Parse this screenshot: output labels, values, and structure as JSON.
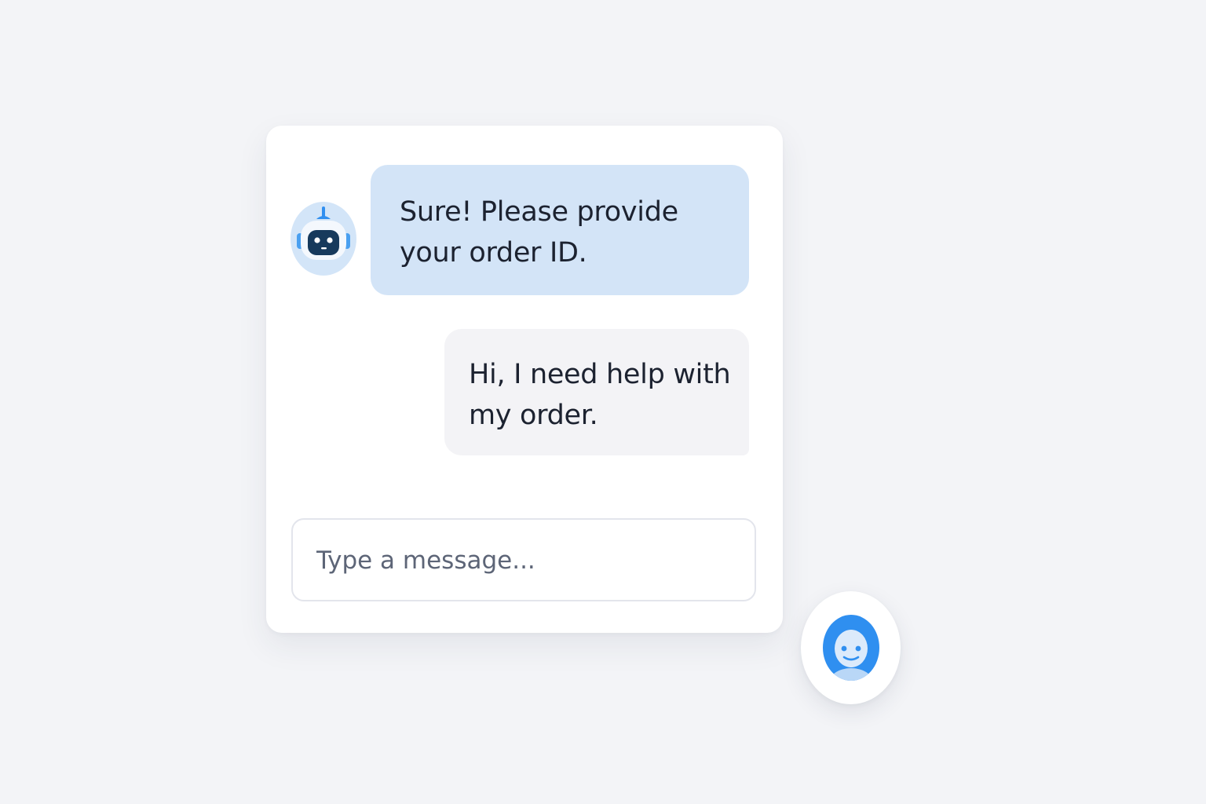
{
  "chat": {
    "messages": [
      {
        "sender": "bot",
        "text": "Sure! Please provide your order ID."
      },
      {
        "sender": "user",
        "text": "Hi, I need help with my order."
      }
    ],
    "input": {
      "placeholder": "Type a message...",
      "value": ""
    }
  },
  "icons": {
    "bot_avatar": "robot-icon",
    "launcher": "chatbot-face-icon"
  },
  "colors": {
    "background": "#f3f4f7",
    "panel": "#ffffff",
    "bot_bubble": "#d3e4f7",
    "user_bubble": "#f3f3f6",
    "accent": "#2f8ff0",
    "text": "#1c2230"
  }
}
